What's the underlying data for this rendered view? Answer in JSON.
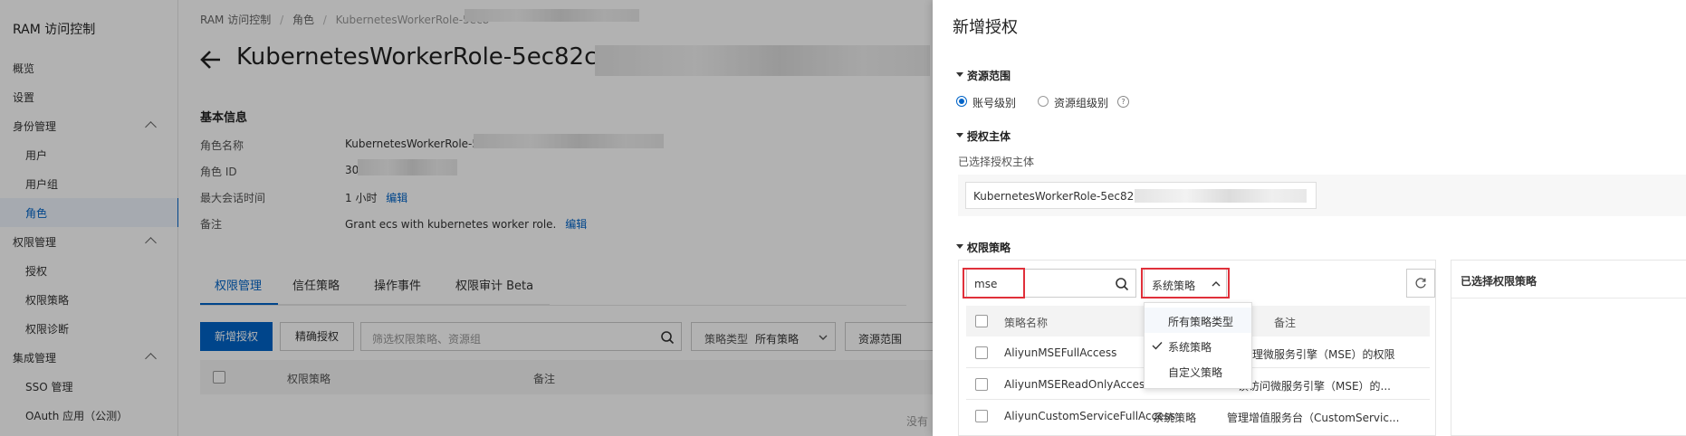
{
  "sidebar": {
    "title": "RAM 访问控制",
    "items": [
      {
        "label": "概览"
      },
      {
        "label": "设置"
      },
      {
        "label": "身份管理"
      },
      {
        "label": "用户"
      },
      {
        "label": "用户组"
      },
      {
        "label": "角色"
      },
      {
        "label": "权限管理"
      },
      {
        "label": "授权"
      },
      {
        "label": "权限策略"
      },
      {
        "label": "权限诊断"
      },
      {
        "label": "集成管理"
      },
      {
        "label": "SSO 管理"
      },
      {
        "label": "OAuth 应用（公测）"
      }
    ]
  },
  "main": {
    "breadcrumb": [
      "RAM 访问控制",
      "角色",
      "KubernetesWorkerRole-5ec8"
    ],
    "title": "KubernetesWorkerRole-5ec82c",
    "basic_info": {
      "heading": "基本信息",
      "rows": [
        {
          "key": "角色名称",
          "value": "KubernetesWorkerRole-5ec"
        },
        {
          "key": "角色 ID",
          "value": "30"
        },
        {
          "key": "最大会话时间",
          "value": "1 小时",
          "link": "编辑"
        },
        {
          "key": "备注",
          "value": "Grant ecs with kubernetes worker role.",
          "link": "编辑"
        }
      ]
    },
    "tabs": [
      {
        "label": "权限管理"
      },
      {
        "label": "信任策略"
      },
      {
        "label": "操作事件"
      },
      {
        "label": "权限审计 Beta"
      }
    ],
    "toolbar": {
      "add_grant": "新增授权",
      "precise_grant": "精确授权",
      "filter_placeholder": "筛选权限策略、资源组",
      "policy_type_label": "策略类型",
      "policy_type_value": "所有策略",
      "resource_scope": "资源范围"
    },
    "table": {
      "columns": [
        "权限策略",
        "备注"
      ],
      "empty_hint": "没有"
    }
  },
  "drawer": {
    "title": "新增授权",
    "resource_scope": {
      "heading": "资源范围",
      "options": [
        {
          "label": "账号级别",
          "selected": true
        },
        {
          "label": "资源组级别",
          "selected": false
        }
      ]
    },
    "principal": {
      "heading": "授权主体",
      "label": "已选择授权主体",
      "value": "KubernetesWorkerRole-5ec82d"
    },
    "policies": {
      "heading": "权限策略",
      "search_value": "mse",
      "type_select": "系统策略",
      "selected_panel_title": "已选择权限策略",
      "columns": [
        "策略名称",
        "备注"
      ],
      "rows": [
        {
          "name": "AliyunMSEFullAccess",
          "type": "",
          "desc": "理微服务引擎（MSE）的权限"
        },
        {
          "name": "AliyunMSEReadOnlyAccess",
          "type": "",
          "desc": "读访问微服务引擎（MSE）的..."
        },
        {
          "name": "AliyunCustomServiceFullAccess",
          "type": "系统策略",
          "desc": "管理增值服务台（CustomServic..."
        }
      ],
      "dropdown": {
        "options": [
          {
            "label": "所有策略类型",
            "checked": false
          },
          {
            "label": "系统策略",
            "checked": true
          },
          {
            "label": "自定义策略",
            "checked": false
          }
        ]
      }
    }
  },
  "colors": {
    "accent": "#0064c8",
    "highlight": "#e0303a",
    "overlay": "rgba(0,0,0,0.30)"
  }
}
